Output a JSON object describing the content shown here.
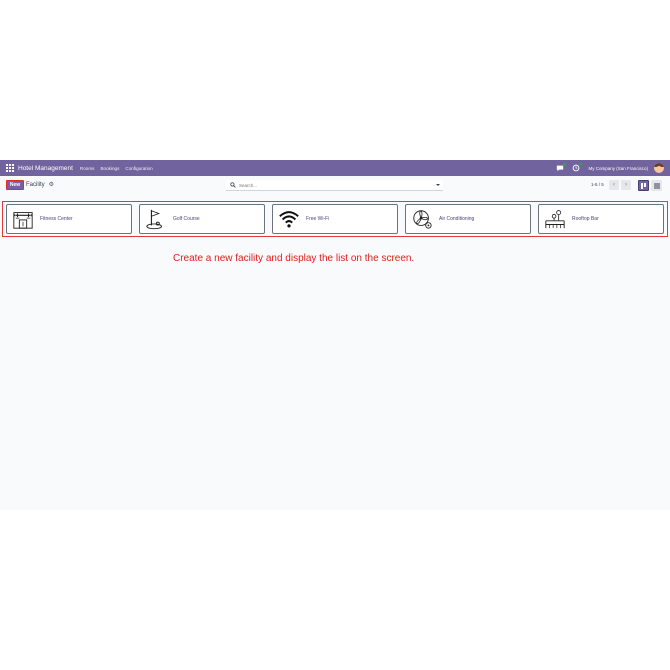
{
  "navbar": {
    "brand": "Hotel Management",
    "menu": [
      "Rooms",
      "Bookings",
      "Configuration"
    ],
    "company": "My Company (San Francisco)",
    "icons": [
      "apps-grid-icon",
      "chat-icon",
      "activity-clock-icon",
      "user-avatar"
    ]
  },
  "control_panel": {
    "new_label": "New",
    "breadcrumb": "Facility",
    "gear_glyph": "⚙",
    "search_placeholder": "Search...",
    "pager": "1-5 / 5",
    "prev_glyph": "‹",
    "next_glyph": "›"
  },
  "facilities": [
    {
      "name": "Fitness Center",
      "icon": "gym-icon"
    },
    {
      "name": "Golf Course",
      "icon": "golf-flag-icon"
    },
    {
      "name": "Free Wi-Fi",
      "icon": "wifi-icon"
    },
    {
      "name": "Air Conditioning",
      "icon": "fan-icon"
    },
    {
      "name": "Rooftop Bar",
      "icon": "rooftop-bar-icon"
    }
  ],
  "instruction": "Create a new facility and display the list on the screen.",
  "colors": {
    "brand": "#71639e",
    "highlight": "#e53935",
    "instruction": "#e01e1e"
  }
}
